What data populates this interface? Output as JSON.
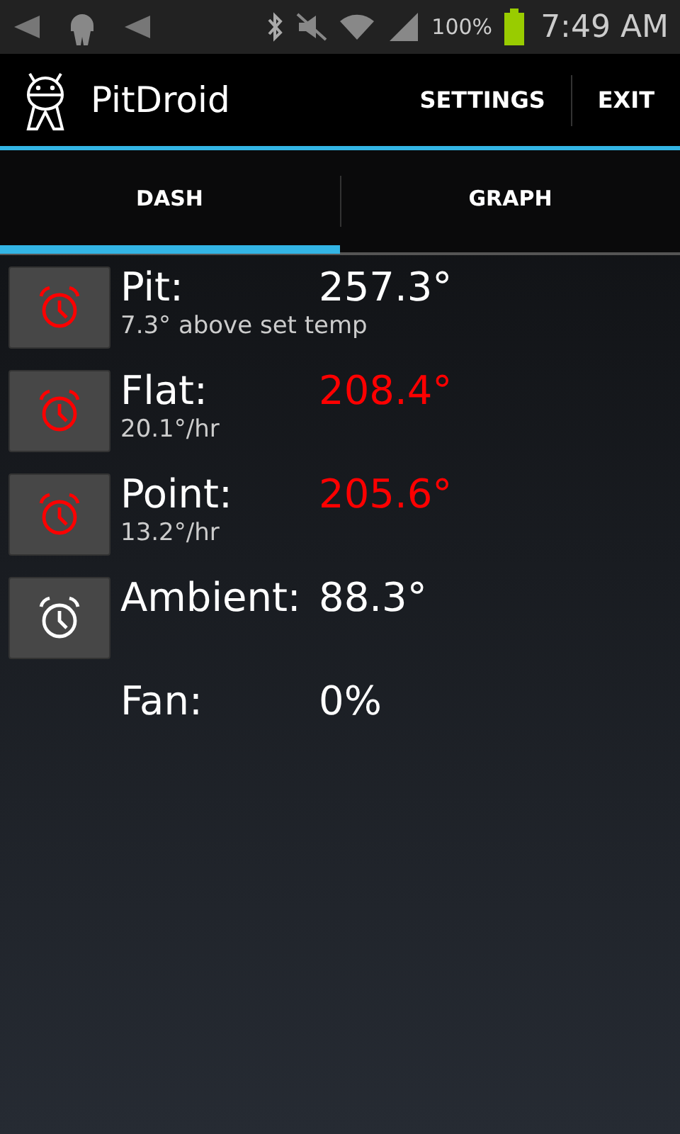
{
  "status_bar": {
    "battery_text": "100%",
    "time": "7:49 AM"
  },
  "action_bar": {
    "title": "PitDroid",
    "actions": [
      "SETTINGS",
      "EXIT"
    ]
  },
  "tabs": [
    {
      "label": "DASH",
      "selected": true
    },
    {
      "label": "GRAPH",
      "selected": false
    }
  ],
  "readings": [
    {
      "kind": "alarm",
      "alarm_on": true,
      "label": "Pit:",
      "value": "257.3°",
      "alert": false,
      "detail": "7.3° above set temp"
    },
    {
      "kind": "alarm",
      "alarm_on": true,
      "label": "Flat:",
      "value": "208.4°",
      "alert": true,
      "detail": "20.1°/hr"
    },
    {
      "kind": "alarm",
      "alarm_on": true,
      "label": "Point:",
      "value": "205.6°",
      "alert": true,
      "detail": "13.2°/hr"
    },
    {
      "kind": "alarm",
      "alarm_on": false,
      "label": "Ambient:",
      "value": "88.3°",
      "alert": false
    },
    {
      "kind": "plain",
      "label": "Fan:",
      "value": "0%",
      "alert": false
    }
  ]
}
